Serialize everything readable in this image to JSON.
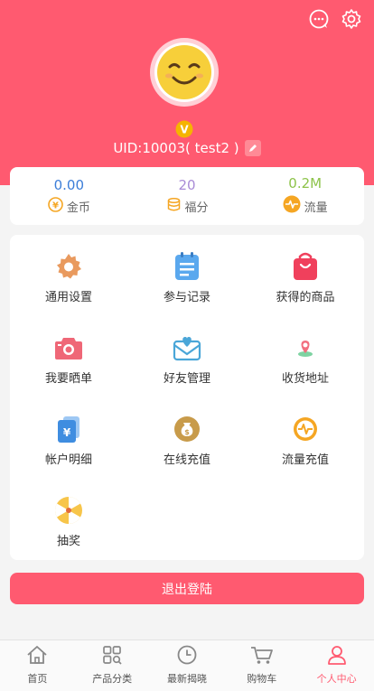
{
  "colors": {
    "primary": "#ff5a70",
    "gold": "#f5a623",
    "blue": "#3b7dd8",
    "purple": "#a98bd6",
    "green": "#8dc34a"
  },
  "header": {
    "uid_text": "UID:10003( test2 )",
    "icons": [
      "chat-bubble-icon",
      "gear-icon"
    ]
  },
  "stats": [
    {
      "value": "0.00",
      "label": "金币",
      "icon": "yen-coin-icon",
      "color": "#3b7dd8"
    },
    {
      "value": "20",
      "label": "福分",
      "icon": "coin-stack-icon",
      "color": "#a98bd6"
    },
    {
      "value": "0.2M",
      "label": "流量",
      "icon": "pulse-icon",
      "color": "#8dc34a"
    }
  ],
  "menu": [
    {
      "label": "通用设置",
      "icon": "settings-gear-icon"
    },
    {
      "label": "参与记录",
      "icon": "clipboard-list-icon"
    },
    {
      "label": "获得的商品",
      "icon": "shopping-bag-icon"
    },
    {
      "label": "我要晒单",
      "icon": "camera-icon"
    },
    {
      "label": "好友管理",
      "icon": "heart-envelope-icon"
    },
    {
      "label": "收货地址",
      "icon": "location-pin-icon"
    },
    {
      "label": "帐户明细",
      "icon": "wallet-card-icon"
    },
    {
      "label": "在线充值",
      "icon": "money-bag-icon"
    },
    {
      "label": "流量充值",
      "icon": "traffic-pulse-icon"
    },
    {
      "label": "抽奖",
      "icon": "prize-wheel-icon"
    }
  ],
  "logout_label": "退出登陆",
  "tabs": [
    {
      "label": "首页",
      "icon": "home-icon"
    },
    {
      "label": "产品分类",
      "icon": "category-grid-icon"
    },
    {
      "label": "最新揭晓",
      "icon": "clock-icon"
    },
    {
      "label": "购物车",
      "icon": "cart-icon"
    },
    {
      "label": "个人中心",
      "icon": "user-icon",
      "active": true
    }
  ]
}
